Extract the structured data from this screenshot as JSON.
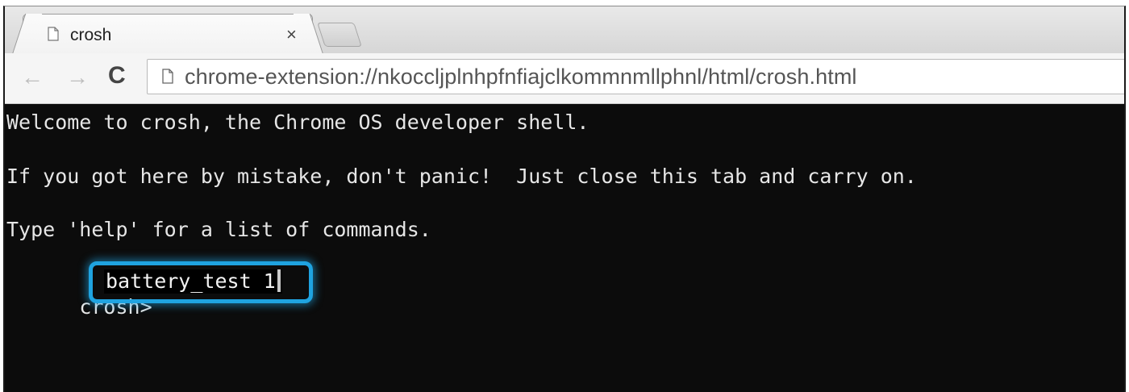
{
  "tab": {
    "title": "crosh",
    "close_glyph": "×",
    "favicon": "page-icon"
  },
  "toolbar": {
    "back_glyph": "←",
    "forward_glyph": "→",
    "reload_glyph": "C",
    "url": "chrome-extension://nkoccljplnhpfnfiajclkommnmllphnl/html/crosh.html"
  },
  "terminal": {
    "lines": [
      "Welcome to crosh, the Chrome OS developer shell.",
      "If you got here by mistake, don't panic!  Just close this tab and carry on.",
      "Type 'help' for a list of commands."
    ],
    "prompt": "crosh>",
    "command": "battery_test 1"
  },
  "colors": {
    "terminal_bg": "#0c0c0c",
    "terminal_text": "#e6e6e6",
    "highlight": "#1fa3e0"
  }
}
